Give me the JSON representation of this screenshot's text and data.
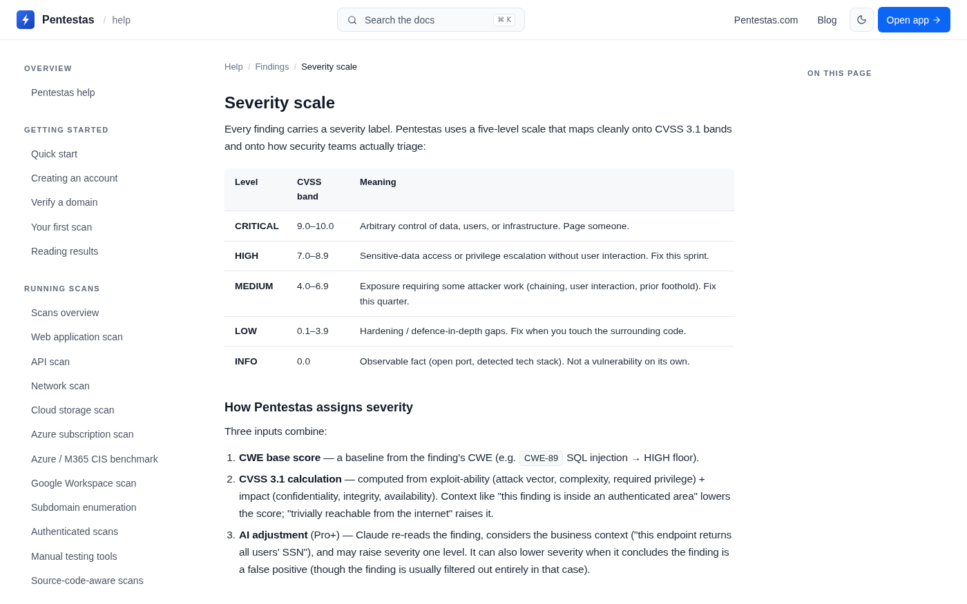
{
  "header": {
    "brand": "Pentestas",
    "separator": "/",
    "section": "help",
    "search": {
      "placeholder": "Search the docs",
      "shortcut": "⌘ K"
    },
    "links": [
      "Pentestas.com",
      "Blog"
    ],
    "cta": "Open app"
  },
  "sidebar": {
    "sections": [
      {
        "heading": "OVERVIEW",
        "items": [
          "Pentestas help"
        ]
      },
      {
        "heading": "GETTING STARTED",
        "items": [
          "Quick start",
          "Creating an account",
          "Verify a domain",
          "Your first scan",
          "Reading results"
        ]
      },
      {
        "heading": "RUNNING SCANS",
        "items": [
          "Scans overview",
          "Web application scan",
          "API scan",
          "Network scan",
          "Cloud storage scan",
          "Azure subscription scan",
          "Azure / M365 CIS benchmark",
          "Google Workspace scan",
          "Subdomain enumeration",
          "Authenticated scans",
          "Manual testing tools",
          "Source-code-aware scans"
        ]
      }
    ]
  },
  "breadcrumb": [
    {
      "kind": "link",
      "label": "Help",
      "current": false
    },
    {
      "kind": "separator",
      "label": "/"
    },
    {
      "kind": "link",
      "label": "Findings",
      "current": false
    },
    {
      "kind": "separator",
      "label": "/"
    },
    {
      "kind": "link",
      "label": "Severity scale",
      "current": true
    }
  ],
  "article": {
    "title": "Severity scale",
    "lead": "Every finding carries a severity label. Pentestas uses a five-level scale that maps cleanly onto CVSS 3.1 bands and onto how security teams actually triage:",
    "table": {
      "columns": [
        "Level",
        "CVSS band",
        "Meaning"
      ],
      "rows": [
        {
          "level": "CRITICAL",
          "band": "9.0–10.0",
          "meaning": "Arbitrary control of data, users, or infrastructure. Page someone."
        },
        {
          "level": "HIGH",
          "band": "7.0–8.9",
          "meaning": "Sensitive-data access or privilege escalation without user interaction. Fix this sprint."
        },
        {
          "level": "MEDIUM",
          "band": "4.0–6.9",
          "meaning": "Exposure requiring some attacker work (chaining, user interaction, prior foothold). Fix this quarter."
        },
        {
          "level": "LOW",
          "band": "0.1–3.9",
          "meaning": "Hardening / defence-in-depth gaps. Fix when you touch the surrounding code."
        },
        {
          "level": "INFO",
          "band": "0.0",
          "meaning": "Observable fact (open port, detected tech stack). Not a vulnerability on its own."
        }
      ]
    },
    "subheading": "How Pentestas assigns severity",
    "intro": "Three inputs combine:",
    "steps": [
      {
        "number": "1.",
        "parts": [
          {
            "kind": "text",
            "text": "**CWE base score** — a baseline from the finding's CWE (e.g."
          },
          {
            "kind": "code",
            "text": "CWE-89"
          },
          {
            "kind": "text",
            "text": "SQL injection → HIGH floor)."
          }
        ]
      },
      {
        "number": "2.",
        "parts": [
          {
            "kind": "text",
            "text": "**CVSS 3.1 calculation** — computed from exploit-ability (attack vector, complexity, required privilege) + impact (confidentiality, integrity, availability). Context like \"this finding is inside an authenticated area\" lowers the score; \"trivially reachable from the internet\" raises it."
          }
        ]
      },
      {
        "number": "3.",
        "parts": [
          {
            "kind": "text",
            "text": "**AI adjustment** (Pro+) — Claude re-reads the finding, considers the business context (\"this endpoint returns all users' SSN\"), and may raise severity one level. It can also lower severity when it concludes the finding is a false positive (though the finding is usually filtered out entirely in that case)."
          }
        ]
      }
    ]
  },
  "toc": {
    "heading": "ON THIS PAGE"
  }
}
